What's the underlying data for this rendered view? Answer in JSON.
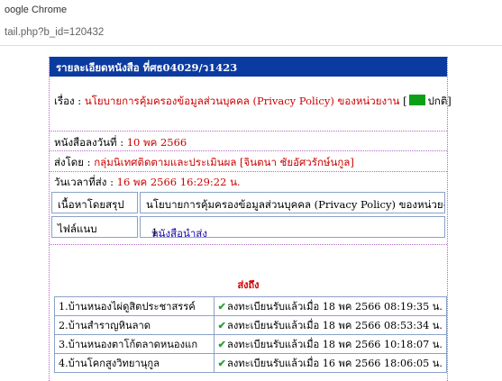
{
  "browser": {
    "title": "oogle Chrome",
    "url": "tail.php?b_id=120432"
  },
  "document": {
    "header": "รายละเอียดหนังสือ ที่ศธ04029/ว1423",
    "subject_label": "เรื่อง :",
    "subject_value": "นโยบายการคุ้มครองข้อมูลส่วนบุคคล (Privacy Policy) ของหน่วยงาน",
    "status_open": "[",
    "status_text": "ปกติ]",
    "date_label": "หนังสือลงวันที่ :",
    "date_value": "10 พค 2566",
    "sender_label": "ส่งโดย :",
    "sender_value": "กลุ่มนิเทศติดตามและประเมินผล [จินตนา ชัยอัศวรักษ์นกูล]",
    "sent_time_label": "วันเวลาที่ส่ง :",
    "sent_time_value": "16 พค 2566 16:29:22 น.",
    "summary_label": "เนื้อหาโดยสรุป",
    "summary_value": "นโยบายการคุ้มครองข้อมูลส่วนบุคคล (Privacy Policy) ของหน่วยงาน",
    "attachment_label": "ไฟล์แนบ",
    "attachment_number": "1.",
    "attachment_link": "หนังสือนำส่ง",
    "recipients_title": "ส่งถึง",
    "recipients": [
      {
        "school": "1.บ้านหนองไผ่ดูสิตประชาสรรค์",
        "status": "ลงทะเบียนรับแล้วเมื่อ 18 พค 2566 08:19:35 น."
      },
      {
        "school": "2.บ้านสำราญหินลาด",
        "status": "ลงทะเบียนรับแล้วเมื่อ 18 พค 2566 08:53:34 น."
      },
      {
        "school": "3.บ้านหนองตาโก้ตลาดหนองแก",
        "status": "ลงทะเบียนรับแล้วเมื่อ 18 พค 2566 10:18:07 น."
      },
      {
        "school": "4.บ้านโคกสูงวิทยานุกูล",
        "status": "ลงทะเบียนรับแล้วเมื่อ 16 พค 2566 18:06:05 น."
      }
    ],
    "colors": {
      "header_bg": "#0b3ba0",
      "value_red": "#cc0000",
      "status_green": "#0aa016"
    },
    "icons": {
      "received": "green-check-icon",
      "status": "green-flag-icon"
    }
  }
}
